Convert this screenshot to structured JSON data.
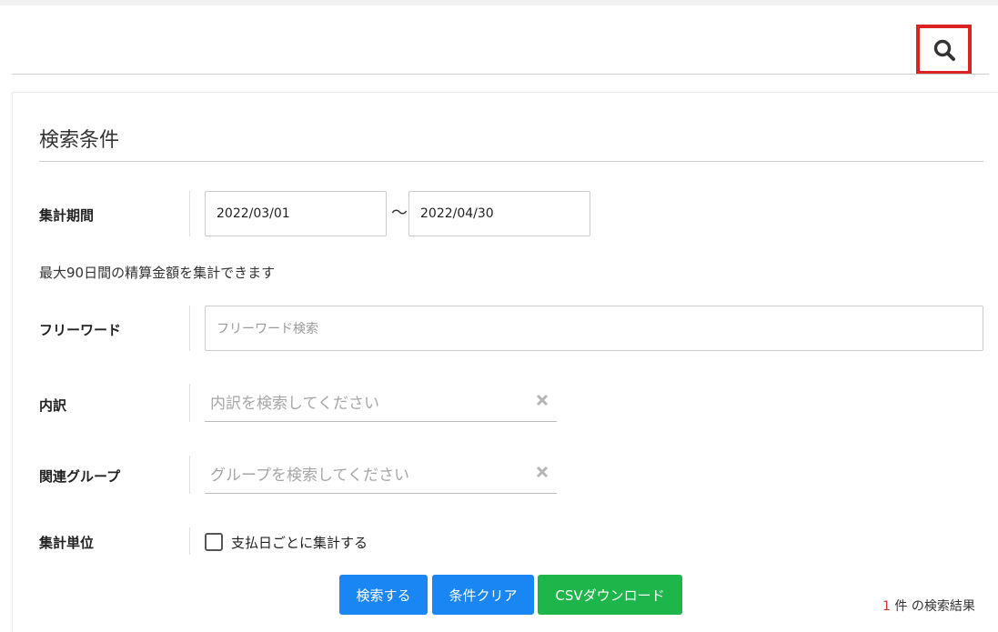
{
  "header": {
    "search_icon": "search-icon"
  },
  "panel": {
    "title": "検索条件",
    "period": {
      "label": "集計期間",
      "from": "2022/03/01",
      "separator": "〜",
      "to": "2022/04/30",
      "note": "最大90日間の精算金額を集計できます"
    },
    "freeword": {
      "label": "フリーワード",
      "placeholder": "フリーワード検索"
    },
    "breakdown": {
      "label": "内訳",
      "placeholder": "内訳を検索してください",
      "clear_icon": "close-icon"
    },
    "group": {
      "label": "関連グループ",
      "placeholder": "グループを検索してください",
      "clear_icon": "close-icon"
    },
    "unit": {
      "label": "集計単位",
      "checkbox_label": "支払日ごとに集計する",
      "checked": false
    },
    "buttons": {
      "search": "検索する",
      "clear": "条件クリア",
      "csv": "CSVダウンロード"
    },
    "result": {
      "count": "1",
      "suffix": "件 の検索結果"
    }
  },
  "colors": {
    "primary": "#1a86f4",
    "success": "#1cb64a",
    "highlight": "#dd2222",
    "count": "#d0342c"
  }
}
